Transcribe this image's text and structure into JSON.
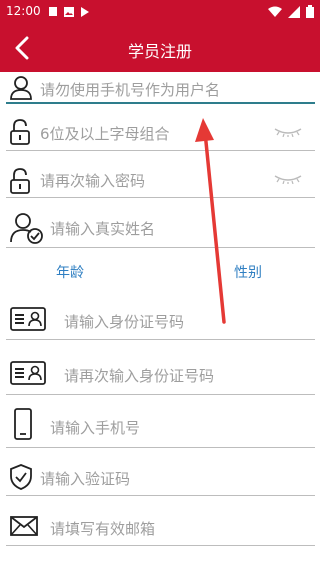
{
  "status": {
    "time": "12:00"
  },
  "header": {
    "title": "学员注册"
  },
  "form": {
    "username_placeholder": "请勿使用手机号作为用户名",
    "password_placeholder": "6位及以上字母组合",
    "confirm_password_placeholder": "请再次输入密码",
    "realname_placeholder": "请输入真实姓名",
    "idcard_placeholder": "请输入身份证号码",
    "idcard_confirm_placeholder": "请再次输入身份证号码",
    "phone_placeholder": "请输入手机号",
    "code_placeholder": "请输入验证码",
    "email_placeholder": "请填写有效邮箱"
  },
  "tabs": {
    "age": "年龄",
    "gender": "性别"
  },
  "colors": {
    "brand": "#c8102e",
    "accent_blue": "#2f7fc2",
    "focus": "#2e7d8c",
    "annotation": "#e53935"
  }
}
